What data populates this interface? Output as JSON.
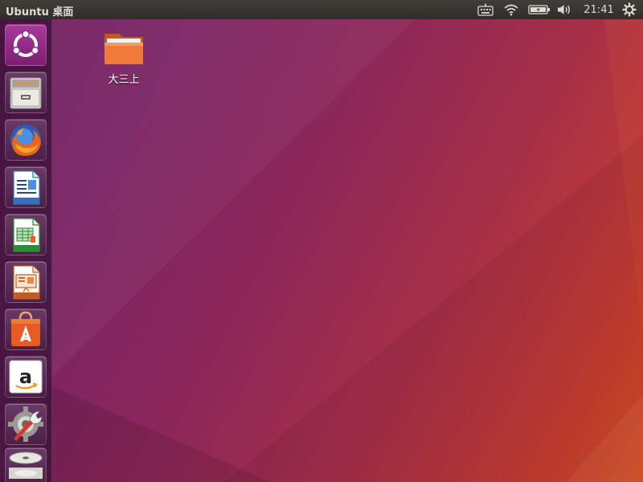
{
  "top_panel": {
    "title": "Ubuntu 桌面",
    "clock": "21:41",
    "indicators": [
      "keyboard-icon",
      "wifi-icon",
      "battery-icon",
      "volume-icon",
      "power-icon"
    ]
  },
  "launcher": {
    "items": [
      {
        "name": "ubuntu-dash",
        "icon": "ubuntu-logo-icon"
      },
      {
        "name": "files",
        "icon": "file-cabinet-icon"
      },
      {
        "name": "firefox",
        "icon": "firefox-icon"
      },
      {
        "name": "libreoffice-writer",
        "icon": "writer-icon"
      },
      {
        "name": "libreoffice-calc",
        "icon": "calc-icon"
      },
      {
        "name": "libreoffice-impress",
        "icon": "impress-icon"
      },
      {
        "name": "ubuntu-software",
        "icon": "shopping-bag-icon"
      },
      {
        "name": "amazon",
        "icon": "amazon-icon"
      },
      {
        "name": "system-settings",
        "icon": "settings-wrench-icon"
      },
      {
        "name": "optical-disc",
        "icon": "disc-icon"
      }
    ]
  },
  "desktop": {
    "icons": [
      {
        "label": "大三上",
        "icon": "folder-icon"
      }
    ]
  },
  "colors": {
    "panel": "#3c3b37",
    "wallpaper_start": "#6d1c5e",
    "wallpaper_end": "#d8501f",
    "folder": "#f07a3a"
  }
}
